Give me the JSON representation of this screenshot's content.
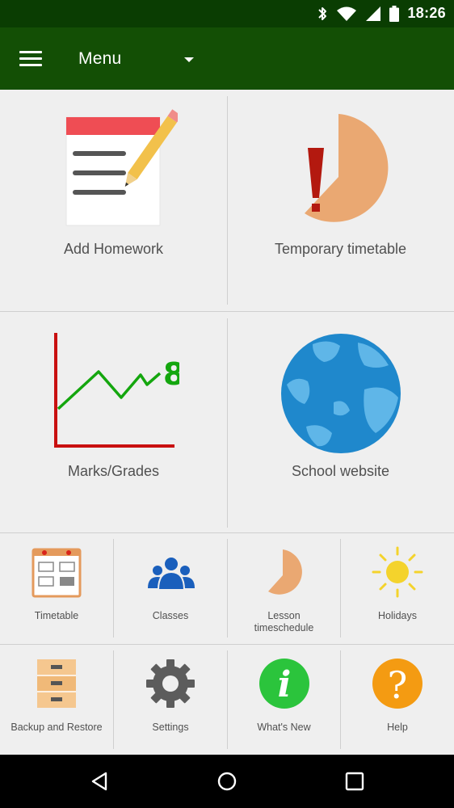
{
  "status_bar": {
    "time": "18:26",
    "icons": [
      "bluetooth-icon",
      "wifi-icon",
      "signal-icon",
      "battery-icon"
    ]
  },
  "app_bar": {
    "title": "Menu",
    "menu_icon": "hamburger-icon",
    "dropdown_icon": "dropdown-arrow-icon",
    "color": "#134f05",
    "status_color": "#0a3d02"
  },
  "main_tiles": [
    {
      "label": "Add Homework",
      "icon": "notepad-pencil-icon"
    },
    {
      "label": "Temporary timetable",
      "icon": "exclamation-clock-icon"
    },
    {
      "label": "Marks/Grades",
      "icon": "grade-chart-icon"
    },
    {
      "label": "School website",
      "icon": "globe-icon"
    }
  ],
  "small_tiles": [
    {
      "label": "Timetable",
      "icon": "timetable-icon"
    },
    {
      "label": "Classes",
      "icon": "people-icon"
    },
    {
      "label": "Lesson\ntimeschedule",
      "icon": "pie-clock-icon"
    },
    {
      "label": "Holidays",
      "icon": "sun-icon"
    },
    {
      "label": "Backup and Restore",
      "icon": "file-cabinet-icon"
    },
    {
      "label": "Settings",
      "icon": "gear-icon"
    },
    {
      "label": "What's New",
      "icon": "info-icon"
    },
    {
      "label": "Help",
      "icon": "help-icon"
    }
  ],
  "grade_icon_text": "8",
  "info_icon_text": "i",
  "help_icon_text": "?",
  "nav_bar": {
    "icons": [
      "back-icon",
      "home-icon",
      "recents-icon"
    ]
  }
}
